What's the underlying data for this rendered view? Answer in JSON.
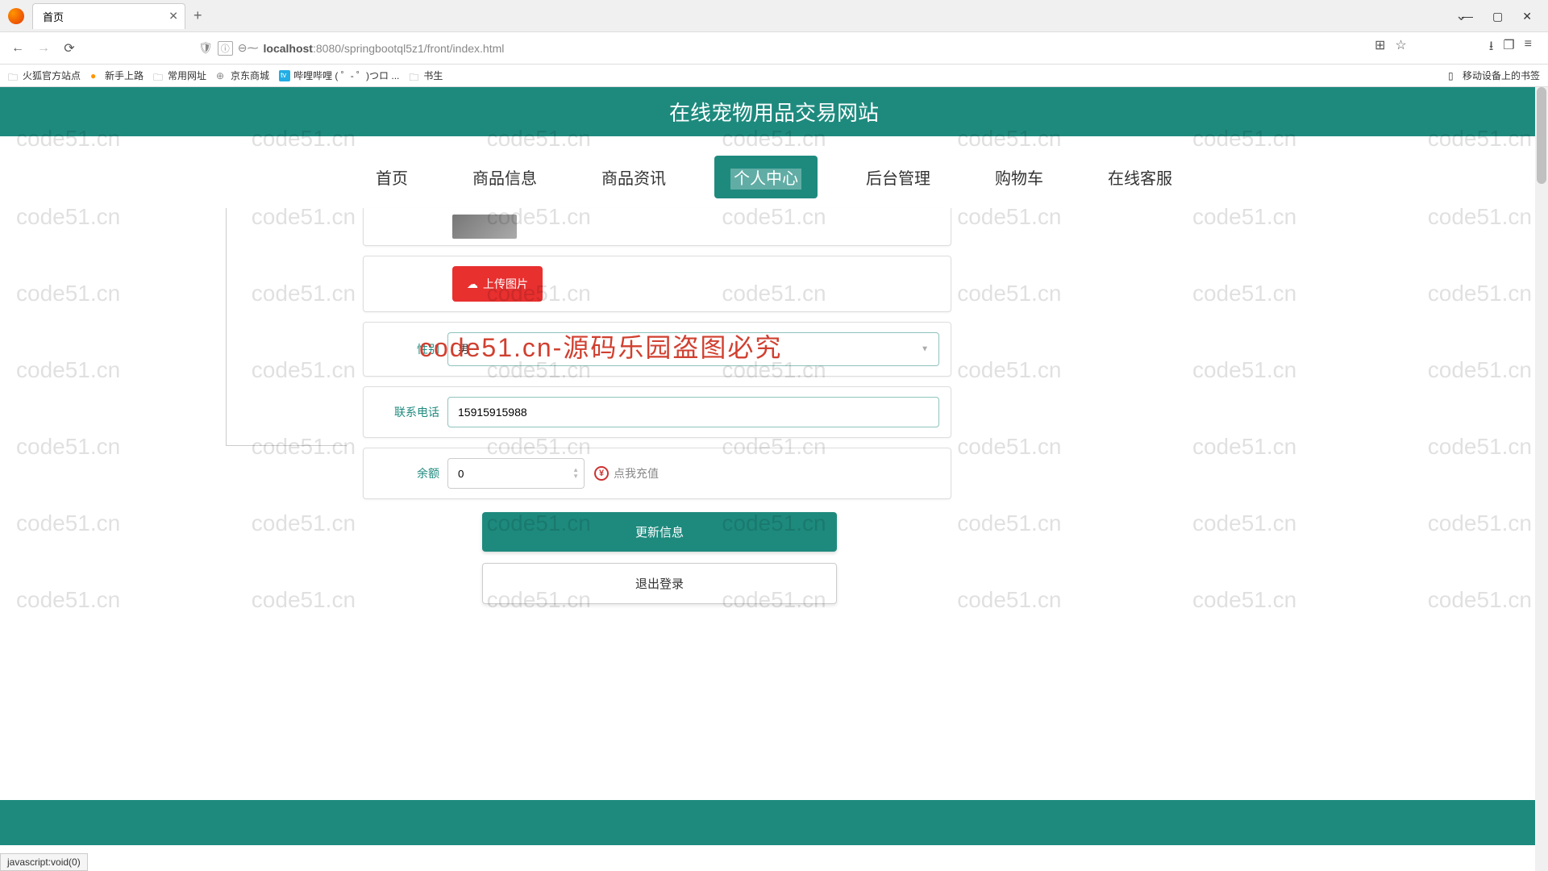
{
  "browser": {
    "tab_title": "首页",
    "url_host": "localhost",
    "url_port": ":8080",
    "url_path": "/springbootql5z1/front/index.html",
    "new_tab": "+",
    "dropdown": "⌄"
  },
  "bookmarks": {
    "items": [
      "火狐官方站点",
      "新手上路",
      "常用网址",
      "京东商城",
      "哔哩哔哩 (  ゜- ゜)つロ ...",
      "书生"
    ],
    "right": "移动设备上的书签"
  },
  "site": {
    "title": "在线宠物用品交易网站"
  },
  "nav": {
    "items": [
      "首页",
      "商品信息",
      "商品资讯",
      "个人中心",
      "后台管理",
      "购物车",
      "在线客服"
    ],
    "active_index": 3
  },
  "form": {
    "upload_label": "上传图片",
    "gender_label": "性别",
    "gender_value": "男",
    "phone_label": "联系电话",
    "phone_value": "15915915988",
    "balance_label": "余额",
    "balance_value": "0",
    "recharge_label": "点我充值",
    "update_btn": "更新信息",
    "logout_btn": "退出登录"
  },
  "status": "javascript:void(0)",
  "watermark": {
    "grey": "code51.cn",
    "red": "code51.cn-源码乐园盗图必究"
  }
}
